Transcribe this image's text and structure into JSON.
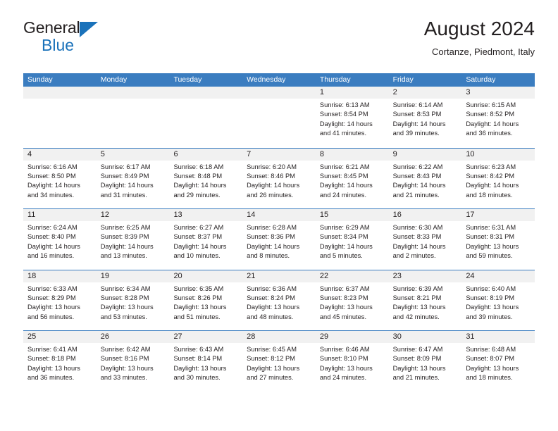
{
  "brand": {
    "name_part1": "General",
    "name_part2": "Blue",
    "triangle_color": "#1a72ba"
  },
  "header": {
    "title": "August 2024",
    "subtitle": "Cortanze, Piedmont, Italy"
  },
  "colors": {
    "header_blue": "#3b7dc0",
    "band_gray": "#f1f1f1",
    "text": "#231f20"
  },
  "calendar": {
    "weekday_headers": [
      "Sunday",
      "Monday",
      "Tuesday",
      "Wednesday",
      "Thursday",
      "Friday",
      "Saturday"
    ],
    "weeks": [
      [
        {
          "day": "",
          "lines": []
        },
        {
          "day": "",
          "lines": []
        },
        {
          "day": "",
          "lines": []
        },
        {
          "day": "",
          "lines": []
        },
        {
          "day": "1",
          "lines": [
            "Sunrise: 6:13 AM",
            "Sunset: 8:54 PM",
            "Daylight: 14 hours",
            "and 41 minutes."
          ]
        },
        {
          "day": "2",
          "lines": [
            "Sunrise: 6:14 AM",
            "Sunset: 8:53 PM",
            "Daylight: 14 hours",
            "and 39 minutes."
          ]
        },
        {
          "day": "3",
          "lines": [
            "Sunrise: 6:15 AM",
            "Sunset: 8:52 PM",
            "Daylight: 14 hours",
            "and 36 minutes."
          ]
        }
      ],
      [
        {
          "day": "4",
          "lines": [
            "Sunrise: 6:16 AM",
            "Sunset: 8:50 PM",
            "Daylight: 14 hours",
            "and 34 minutes."
          ]
        },
        {
          "day": "5",
          "lines": [
            "Sunrise: 6:17 AM",
            "Sunset: 8:49 PM",
            "Daylight: 14 hours",
            "and 31 minutes."
          ]
        },
        {
          "day": "6",
          "lines": [
            "Sunrise: 6:18 AM",
            "Sunset: 8:48 PM",
            "Daylight: 14 hours",
            "and 29 minutes."
          ]
        },
        {
          "day": "7",
          "lines": [
            "Sunrise: 6:20 AM",
            "Sunset: 8:46 PM",
            "Daylight: 14 hours",
            "and 26 minutes."
          ]
        },
        {
          "day": "8",
          "lines": [
            "Sunrise: 6:21 AM",
            "Sunset: 8:45 PM",
            "Daylight: 14 hours",
            "and 24 minutes."
          ]
        },
        {
          "day": "9",
          "lines": [
            "Sunrise: 6:22 AM",
            "Sunset: 8:43 PM",
            "Daylight: 14 hours",
            "and 21 minutes."
          ]
        },
        {
          "day": "10",
          "lines": [
            "Sunrise: 6:23 AM",
            "Sunset: 8:42 PM",
            "Daylight: 14 hours",
            "and 18 minutes."
          ]
        }
      ],
      [
        {
          "day": "11",
          "lines": [
            "Sunrise: 6:24 AM",
            "Sunset: 8:40 PM",
            "Daylight: 14 hours",
            "and 16 minutes."
          ]
        },
        {
          "day": "12",
          "lines": [
            "Sunrise: 6:25 AM",
            "Sunset: 8:39 PM",
            "Daylight: 14 hours",
            "and 13 minutes."
          ]
        },
        {
          "day": "13",
          "lines": [
            "Sunrise: 6:27 AM",
            "Sunset: 8:37 PM",
            "Daylight: 14 hours",
            "and 10 minutes."
          ]
        },
        {
          "day": "14",
          "lines": [
            "Sunrise: 6:28 AM",
            "Sunset: 8:36 PM",
            "Daylight: 14 hours",
            "and 8 minutes."
          ]
        },
        {
          "day": "15",
          "lines": [
            "Sunrise: 6:29 AM",
            "Sunset: 8:34 PM",
            "Daylight: 14 hours",
            "and 5 minutes."
          ]
        },
        {
          "day": "16",
          "lines": [
            "Sunrise: 6:30 AM",
            "Sunset: 8:33 PM",
            "Daylight: 14 hours",
            "and 2 minutes."
          ]
        },
        {
          "day": "17",
          "lines": [
            "Sunrise: 6:31 AM",
            "Sunset: 8:31 PM",
            "Daylight: 13 hours",
            "and 59 minutes."
          ]
        }
      ],
      [
        {
          "day": "18",
          "lines": [
            "Sunrise: 6:33 AM",
            "Sunset: 8:29 PM",
            "Daylight: 13 hours",
            "and 56 minutes."
          ]
        },
        {
          "day": "19",
          "lines": [
            "Sunrise: 6:34 AM",
            "Sunset: 8:28 PM",
            "Daylight: 13 hours",
            "and 53 minutes."
          ]
        },
        {
          "day": "20",
          "lines": [
            "Sunrise: 6:35 AM",
            "Sunset: 8:26 PM",
            "Daylight: 13 hours",
            "and 51 minutes."
          ]
        },
        {
          "day": "21",
          "lines": [
            "Sunrise: 6:36 AM",
            "Sunset: 8:24 PM",
            "Daylight: 13 hours",
            "and 48 minutes."
          ]
        },
        {
          "day": "22",
          "lines": [
            "Sunrise: 6:37 AM",
            "Sunset: 8:23 PM",
            "Daylight: 13 hours",
            "and 45 minutes."
          ]
        },
        {
          "day": "23",
          "lines": [
            "Sunrise: 6:39 AM",
            "Sunset: 8:21 PM",
            "Daylight: 13 hours",
            "and 42 minutes."
          ]
        },
        {
          "day": "24",
          "lines": [
            "Sunrise: 6:40 AM",
            "Sunset: 8:19 PM",
            "Daylight: 13 hours",
            "and 39 minutes."
          ]
        }
      ],
      [
        {
          "day": "25",
          "lines": [
            "Sunrise: 6:41 AM",
            "Sunset: 8:18 PM",
            "Daylight: 13 hours",
            "and 36 minutes."
          ]
        },
        {
          "day": "26",
          "lines": [
            "Sunrise: 6:42 AM",
            "Sunset: 8:16 PM",
            "Daylight: 13 hours",
            "and 33 minutes."
          ]
        },
        {
          "day": "27",
          "lines": [
            "Sunrise: 6:43 AM",
            "Sunset: 8:14 PM",
            "Daylight: 13 hours",
            "and 30 minutes."
          ]
        },
        {
          "day": "28",
          "lines": [
            "Sunrise: 6:45 AM",
            "Sunset: 8:12 PM",
            "Daylight: 13 hours",
            "and 27 minutes."
          ]
        },
        {
          "day": "29",
          "lines": [
            "Sunrise: 6:46 AM",
            "Sunset: 8:10 PM",
            "Daylight: 13 hours",
            "and 24 minutes."
          ]
        },
        {
          "day": "30",
          "lines": [
            "Sunrise: 6:47 AM",
            "Sunset: 8:09 PM",
            "Daylight: 13 hours",
            "and 21 minutes."
          ]
        },
        {
          "day": "31",
          "lines": [
            "Sunrise: 6:48 AM",
            "Sunset: 8:07 PM",
            "Daylight: 13 hours",
            "and 18 minutes."
          ]
        }
      ]
    ]
  }
}
